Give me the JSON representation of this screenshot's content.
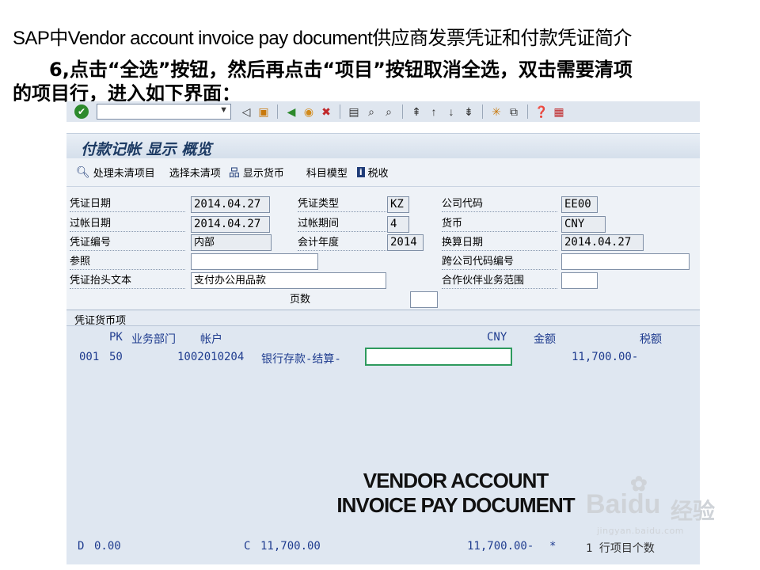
{
  "slide": {
    "title": "SAP中Vendor account invoice pay document供应商发票凭证和付款凭证简介",
    "subtitle_line1": "6,点击“全选”按钮，然后再点击“项目”按钮取消全选，双击需要清项",
    "subtitle_line2": "的项目行，进入如下界面："
  },
  "toolbar": {
    "command_field_value": "",
    "icons": [
      "enter-icon",
      "back-triangle-icon",
      "save-icon",
      "back-icon",
      "exit-icon",
      "cancel-icon",
      "print-icon",
      "find-icon",
      "find-next-icon",
      "first-page-icon",
      "prev-page-icon",
      "next-page-icon",
      "last-page-icon",
      "new-session-icon",
      "shortcut-icon",
      "help-icon",
      "customize-icon"
    ]
  },
  "screen": {
    "title": "付款记帐 显示 概览"
  },
  "app_toolbar": {
    "process_open_items": "处理未清项目",
    "select_open_items": "选择未清项",
    "display_currency": "显示货币",
    "account_model": "科目模型",
    "tax": "税收"
  },
  "header": {
    "doc_date_label": "凭证日期",
    "doc_date": "2014.04.27",
    "doc_type_label": "凭证类型",
    "doc_type": "KZ",
    "company_code_label": "公司代码",
    "company_code": "EE00",
    "posting_date_label": "过帐日期",
    "posting_date": "2014.04.27",
    "period_label": "过帐期间",
    "period": "4",
    "currency_label": "货币",
    "currency": "CNY",
    "doc_number_label": "凭证编号",
    "doc_number": "内部",
    "fiscal_year_label": "会计年度",
    "fiscal_year": "2014",
    "translation_date_label": "换算日期",
    "translation_date": "2014.04.27",
    "reference_label": "参照",
    "reference": "",
    "cross_cc_label": "跨公司代码编号",
    "cross_cc": "",
    "header_text_label": "凭证抬头文本",
    "header_text": "支付办公用品款",
    "partner_ba_label": "合作伙伴业务范围",
    "partner_ba": "",
    "page_label": "页数",
    "page": ""
  },
  "items": {
    "section_title": "凭证货币项",
    "col_pk": "PK",
    "col_bus_dept": "业务部门",
    "col_account": "帐户",
    "col_currency": "CNY",
    "col_amount": "金额",
    "col_tax": "税额",
    "row1": {
      "line": "001",
      "pk": "50",
      "account": "1002010204",
      "text": "银行存款-结算-",
      "amount": "11,700.00-"
    },
    "footer": {
      "debit_label": "D",
      "debit": "0.00",
      "credit_label": "C",
      "credit": "11,700.00",
      "balance": "11,700.00-",
      "balance_marker": "*",
      "count_text": "1 行项目个数"
    }
  },
  "watermark": {
    "line1": "VENDOR ACCOUNT",
    "line2": "INVOICE PAY DOCUMENT"
  },
  "baidu": {
    "brand": "Baidu",
    "jingyan": "经验",
    "url": "jingyan.baidu.com"
  }
}
